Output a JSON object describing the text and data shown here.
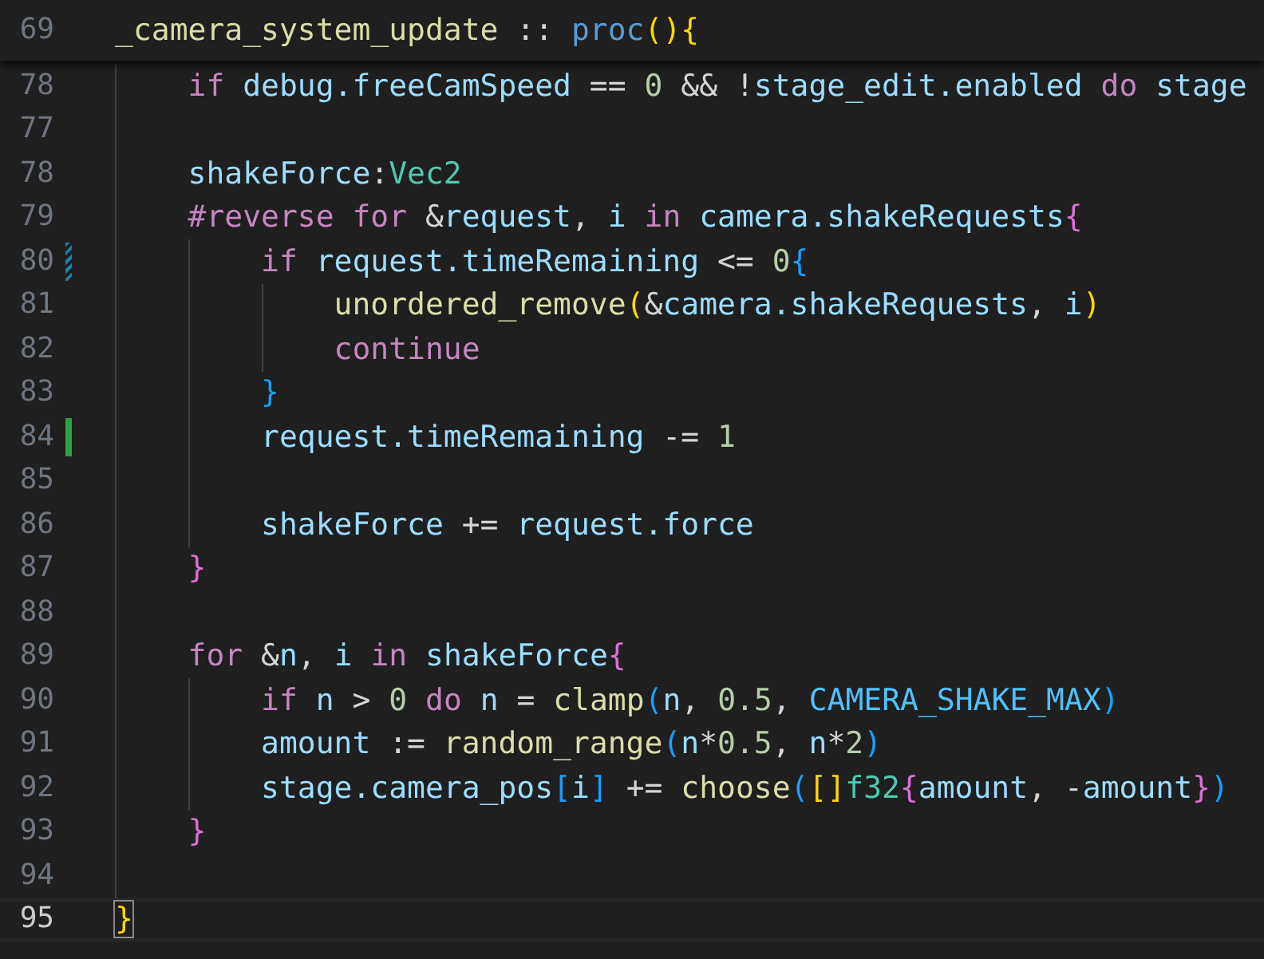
{
  "sticky_line": {
    "number": "69",
    "tokens": [
      {
        "kind": "fn",
        "text": "_camera_system_update"
      },
      {
        "kind": "op",
        "text": " :: "
      },
      {
        "kind": "kw2",
        "text": "proc"
      },
      {
        "kind": "b1",
        "text": "(){"
      }
    ],
    "children": [
      {
        "number": "78",
        "current": false,
        "tokens": [
          {
            "kind": "kw",
            "text": "if "
          },
          {
            "kind": "var",
            "text": "debug.freeCamSpeed"
          },
          {
            "kind": "op",
            "text": " == "
          },
          {
            "kind": "num",
            "text": "0"
          },
          {
            "kind": "op",
            "text": " && !"
          },
          {
            "kind": "var",
            "text": "stage_edit.enabled"
          },
          {
            "kind": "kw",
            "text": " do "
          },
          {
            "kind": "var",
            "text": "stage"
          }
        ]
      },
      {
        "number": "77",
        "current": false
      },
      {
        "number": "78",
        "current": false,
        "tokens": [
          {
            "kind": "var",
            "text": "shakeForce"
          },
          {
            "kind": "op",
            "text": ":"
          },
          {
            "kind": "type",
            "text": "Vec2"
          }
        ]
      },
      {
        "number": "79",
        "current": false,
        "tokens": [
          {
            "kind": "kw",
            "text": "#reverse for "
          },
          {
            "kind": "op",
            "text": "&"
          },
          {
            "kind": "var",
            "text": "request"
          },
          {
            "kind": "op",
            "text": ", "
          },
          {
            "kind": "var",
            "text": "i"
          },
          {
            "kind": "kw",
            "text": " in "
          },
          {
            "kind": "var",
            "text": "camera.shakeRequests"
          },
          {
            "kind": "b2",
            "text": "{"
          }
        ],
        "children": [
          {
            "number": "80",
            "kind": "modified",
            "current": false,
            "tokens": [
              {
                "kind": "kw",
                "text": "if "
              },
              {
                "kind": "var",
                "text": "request.timeRemaining"
              },
              {
                "kind": "op",
                "text": " <= "
              },
              {
                "kind": "num",
                "text": "0"
              },
              {
                "kind": "b3",
                "text": "{"
              }
            ],
            "children": [
              {
                "number": "81",
                "current": false,
                "tokens": [
                  {
                    "kind": "fn",
                    "text": "unordered_remove"
                  },
                  {
                    "kind": "b1",
                    "text": "("
                  },
                  {
                    "kind": "op",
                    "text": "&"
                  },
                  {
                    "kind": "var",
                    "text": "camera.shakeRequests"
                  },
                  {
                    "kind": "op",
                    "text": ", "
                  },
                  {
                    "kind": "var",
                    "text": "i"
                  },
                  {
                    "kind": "b1",
                    "text": ")"
                  }
                ]
              },
              {
                "number": "82",
                "current": false,
                "tokens": [
                  {
                    "kind": "kw",
                    "text": "continue"
                  }
                ]
              }
            ]
          },
          {
            "number": "83",
            "current": false,
            "tokens": [
              {
                "kind": "b3",
                "text": "}"
              }
            ]
          },
          {
            "number": "84",
            "kind": "added",
            "current": false,
            "tokens": [
              {
                "kind": "var",
                "text": "request.timeRemaining"
              },
              {
                "kind": "op",
                "text": " -= "
              },
              {
                "kind": "num",
                "text": "1"
              }
            ]
          },
          {
            "number": "85",
            "current": false
          },
          {
            "number": "86",
            "current": false,
            "tokens": [
              {
                "kind": "var",
                "text": "shakeForce"
              },
              {
                "kind": "op",
                "text": " += "
              },
              {
                "kind": "var",
                "text": "request.force"
              }
            ]
          }
        ]
      },
      {
        "number": "87",
        "current": false,
        "tokens": [
          {
            "kind": "b2",
            "text": "}"
          }
        ]
      },
      {
        "number": "88",
        "current": false
      },
      {
        "number": "89",
        "current": false,
        "tokens": [
          {
            "kind": "kw",
            "text": "for "
          },
          {
            "kind": "op",
            "text": "&"
          },
          {
            "kind": "var",
            "text": "n"
          },
          {
            "kind": "op",
            "text": ", "
          },
          {
            "kind": "var",
            "text": "i"
          },
          {
            "kind": "kw",
            "text": " in "
          },
          {
            "kind": "var",
            "text": "shakeForce"
          },
          {
            "kind": "b2",
            "text": "{"
          }
        ],
        "children": [
          {
            "number": "90",
            "current": false,
            "tokens": [
              {
                "kind": "kw",
                "text": "if "
              },
              {
                "kind": "var",
                "text": "n"
              },
              {
                "kind": "op",
                "text": " > "
              },
              {
                "kind": "num",
                "text": "0"
              },
              {
                "kind": "kw",
                "text": " do "
              },
              {
                "kind": "var",
                "text": "n"
              },
              {
                "kind": "op",
                "text": " = "
              },
              {
                "kind": "fn",
                "text": "clamp"
              },
              {
                "kind": "b3",
                "text": "("
              },
              {
                "kind": "var",
                "text": "n"
              },
              {
                "kind": "op",
                "text": ", "
              },
              {
                "kind": "num",
                "text": "0.5"
              },
              {
                "kind": "op",
                "text": ", "
              },
              {
                "kind": "const",
                "text": "CAMERA_SHAKE_MAX"
              },
              {
                "kind": "b3",
                "text": ")"
              }
            ]
          },
          {
            "number": "91",
            "current": false,
            "tokens": [
              {
                "kind": "var",
                "text": "amount"
              },
              {
                "kind": "op",
                "text": " := "
              },
              {
                "kind": "fn",
                "text": "random_range"
              },
              {
                "kind": "b3",
                "text": "("
              },
              {
                "kind": "var",
                "text": "n"
              },
              {
                "kind": "op",
                "text": "*"
              },
              {
                "kind": "num",
                "text": "0.5"
              },
              {
                "kind": "op",
                "text": ", "
              },
              {
                "kind": "var",
                "text": "n"
              },
              {
                "kind": "op",
                "text": "*"
              },
              {
                "kind": "num",
                "text": "2"
              },
              {
                "kind": "b3",
                "text": ")"
              }
            ]
          },
          {
            "number": "92",
            "current": false,
            "tokens": [
              {
                "kind": "var",
                "text": "stage.camera_pos"
              },
              {
                "kind": "b3",
                "text": "["
              },
              {
                "kind": "var",
                "text": "i"
              },
              {
                "kind": "b3",
                "text": "]"
              },
              {
                "kind": "op",
                "text": " += "
              },
              {
                "kind": "fn",
                "text": "choose"
              },
              {
                "kind": "b3",
                "text": "("
              },
              {
                "kind": "b1",
                "text": "[]"
              },
              {
                "kind": "type",
                "text": "f32"
              },
              {
                "kind": "b2",
                "text": "{"
              },
              {
                "kind": "var",
                "text": "amount"
              },
              {
                "kind": "op",
                "text": ", -"
              },
              {
                "kind": "var",
                "text": "amount"
              },
              {
                "kind": "b2",
                "text": "}"
              },
              {
                "kind": "b3",
                "text": ")"
              }
            ]
          }
        ]
      },
      {
        "number": "93",
        "current": false,
        "tokens": [
          {
            "kind": "b2",
            "text": "}"
          }
        ]
      },
      {
        "number": "94",
        "current": false
      }
    ]
  },
  "closing_line": {
    "number": "95",
    "current": true,
    "tokens": [
      {
        "kind": "bm",
        "text": "}"
      }
    ]
  }
}
